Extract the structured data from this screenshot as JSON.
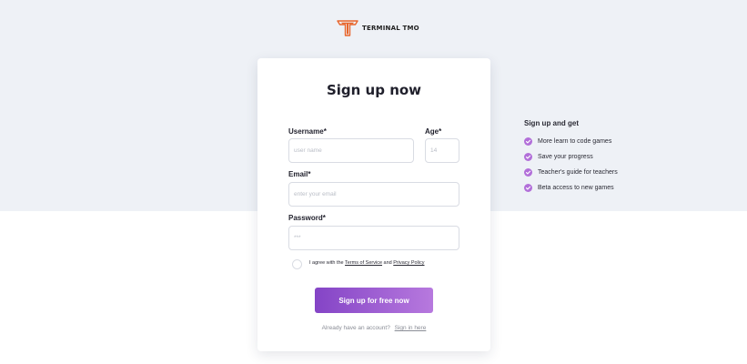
{
  "brand": {
    "name": "TERMINAL TMO",
    "logo_icon": "tmo-logo-icon",
    "accent_color": "#e8652b"
  },
  "form": {
    "title": "Sign up now",
    "username": {
      "label": "Username*",
      "placeholder": "user name"
    },
    "age": {
      "label": "Age*",
      "placeholder": "14"
    },
    "email": {
      "label": "Email*",
      "placeholder": "enter your email"
    },
    "password": {
      "label": "Password*",
      "placeholder": "***"
    },
    "agree": {
      "prefix": "I agree with the",
      "terms_link": "Terms of Service",
      "conjunction": "and",
      "privacy_link": "Privacy Policy"
    },
    "submit_label": "Sign up for free now",
    "signin": {
      "prompt": "Already have an account?",
      "link": "Sign in here"
    },
    "button_gradient": [
      "#8444c6",
      "#b779de"
    ]
  },
  "benefits": {
    "title": "Sign up and get",
    "check_icon": "check-circle-icon",
    "check_color": "#b26fd9",
    "items": [
      "More learn to code games",
      "Save your progress",
      "Teacher's guide for teachers",
      "Beta access to new games"
    ]
  }
}
